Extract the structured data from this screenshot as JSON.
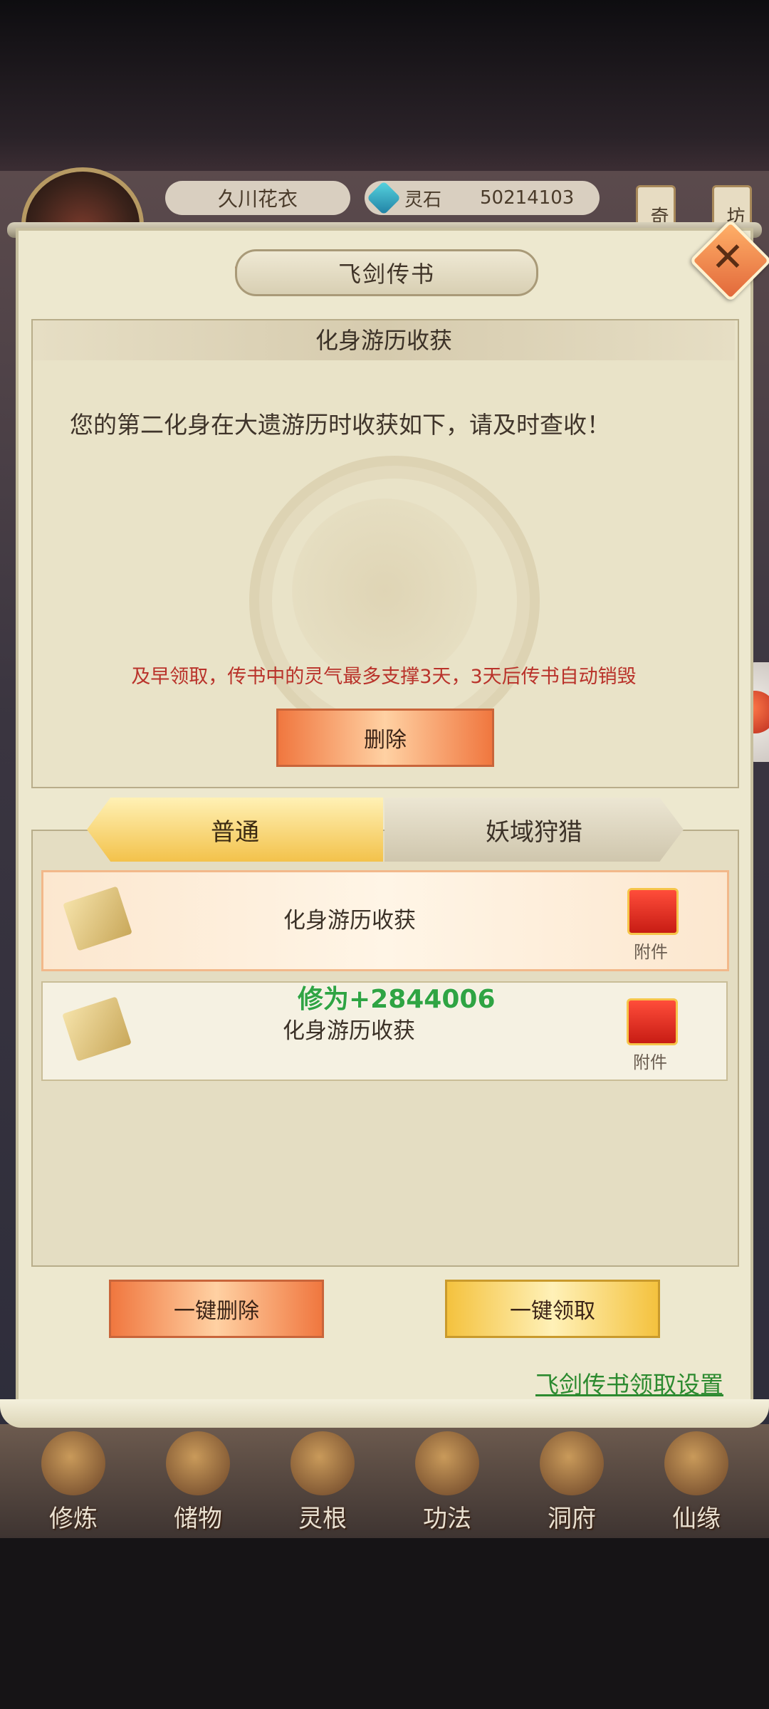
{
  "hud": {
    "player_name": "久川花衣",
    "currency_label": "灵石",
    "currency_value": "50214103",
    "tag_left": "奇",
    "tag_right": "坊",
    "currency_icon": "spirit-stone-icon"
  },
  "dialog": {
    "title": "飞剑传书",
    "close_icon": "close-icon"
  },
  "mail": {
    "subject": "化身游历收获",
    "body": "您的第二化身在大遗游历时收获如下，请及时查收！",
    "warning": "及早领取，传书中的灵气最多支撑3天，3天后传书自动销毁",
    "delete_label": "删除"
  },
  "tabs": [
    {
      "label": "普通",
      "active": true
    },
    {
      "label": "妖域狩猎",
      "active": false
    }
  ],
  "mail_list": [
    {
      "title": "化身游历收获",
      "attachment_label": "附件",
      "selected": true
    },
    {
      "title": "化身游历收获",
      "attachment_label": "附件",
      "selected": false
    }
  ],
  "floating_text": "修为+2844006",
  "actions": {
    "delete_all_label": "一键删除",
    "claim_all_label": "一键领取",
    "settings_link": "飞剑传书领取设置"
  },
  "bottom_nav": [
    {
      "label": "修炼",
      "icon": "cultivate-icon"
    },
    {
      "label": "储物",
      "icon": "storage-bag-icon"
    },
    {
      "label": "灵根",
      "icon": "spirit-root-icon"
    },
    {
      "label": "功法",
      "icon": "technique-book-icon"
    },
    {
      "label": "洞府",
      "icon": "cave-abode-icon"
    },
    {
      "label": "仙缘",
      "icon": "immortal-fate-icon"
    }
  ],
  "colors": {
    "accent_orange": "#f0773f",
    "accent_yellow": "#f4c23e",
    "warning_red": "#b9322a",
    "link_green": "#2c8a2f",
    "float_green": "#2fa443"
  }
}
